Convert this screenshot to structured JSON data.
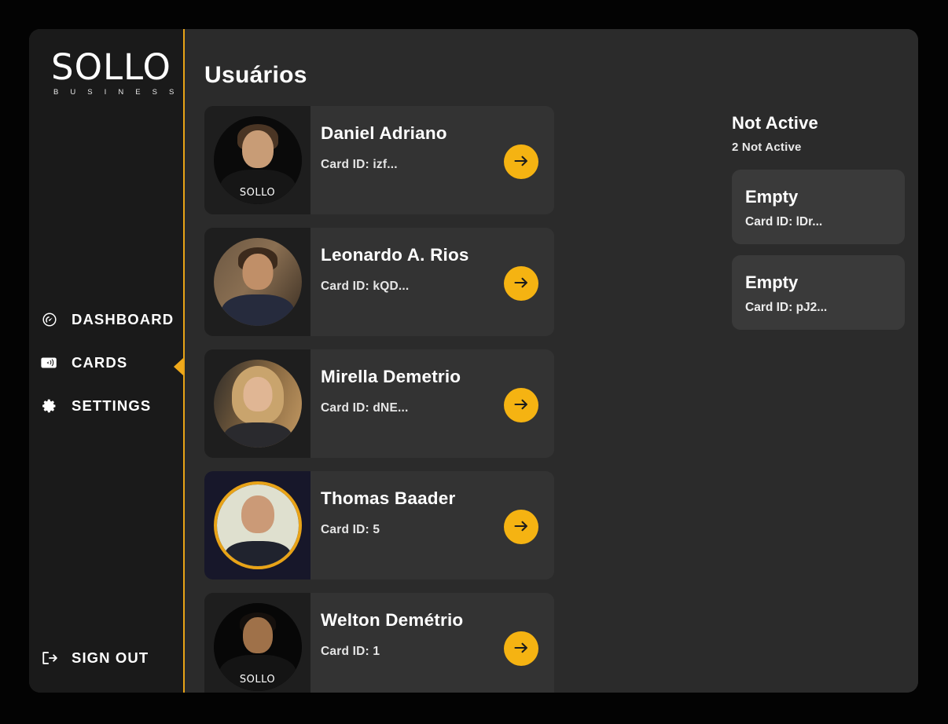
{
  "sidebar": {
    "brand": {
      "word": "SOLLO",
      "sub": "B U S I N E S S"
    },
    "items": [
      {
        "label": "DASHBOARD",
        "icon": "speedometer-icon",
        "active": false
      },
      {
        "label": "CARDS",
        "icon": "rfid-card-icon",
        "active": true
      },
      {
        "label": "SETTINGS",
        "icon": "gear-icon",
        "active": false
      }
    ],
    "signout": {
      "label": "SIGN OUT",
      "icon": "sign-out-icon"
    },
    "accent_color": "#e8a317"
  },
  "main": {
    "title": "Usuários",
    "arrow_button_color": "#f5b312",
    "users": [
      {
        "name": "Daniel Adriano",
        "card_id": "Card ID: izf...",
        "arrow_icon": "arrow-right-icon",
        "avatar_logo": "SOLLO",
        "ringed": false
      },
      {
        "name": "Leonardo A. Rios",
        "card_id": "Card ID: kQD...",
        "arrow_icon": "arrow-right-icon",
        "avatar_logo": "",
        "ringed": false
      },
      {
        "name": "Mirella Demetrio",
        "card_id": "Card ID: dNE...",
        "arrow_icon": "arrow-right-icon",
        "avatar_logo": "",
        "ringed": false
      },
      {
        "name": "Thomas Baader",
        "card_id": "Card ID: 5",
        "arrow_icon": "arrow-right-icon",
        "avatar_logo": "",
        "ringed": true
      },
      {
        "name": "Welton Demétrio",
        "card_id": "Card ID: 1",
        "arrow_icon": "arrow-right-icon",
        "avatar_logo": "SOLLO",
        "ringed": false
      }
    ]
  },
  "not_active": {
    "title": "Not Active",
    "count_label": "2 Not Active",
    "cards": [
      {
        "title": "Empty",
        "card_id": "Card ID: lDr..."
      },
      {
        "title": "Empty",
        "card_id": "Card ID: pJ2..."
      }
    ]
  }
}
